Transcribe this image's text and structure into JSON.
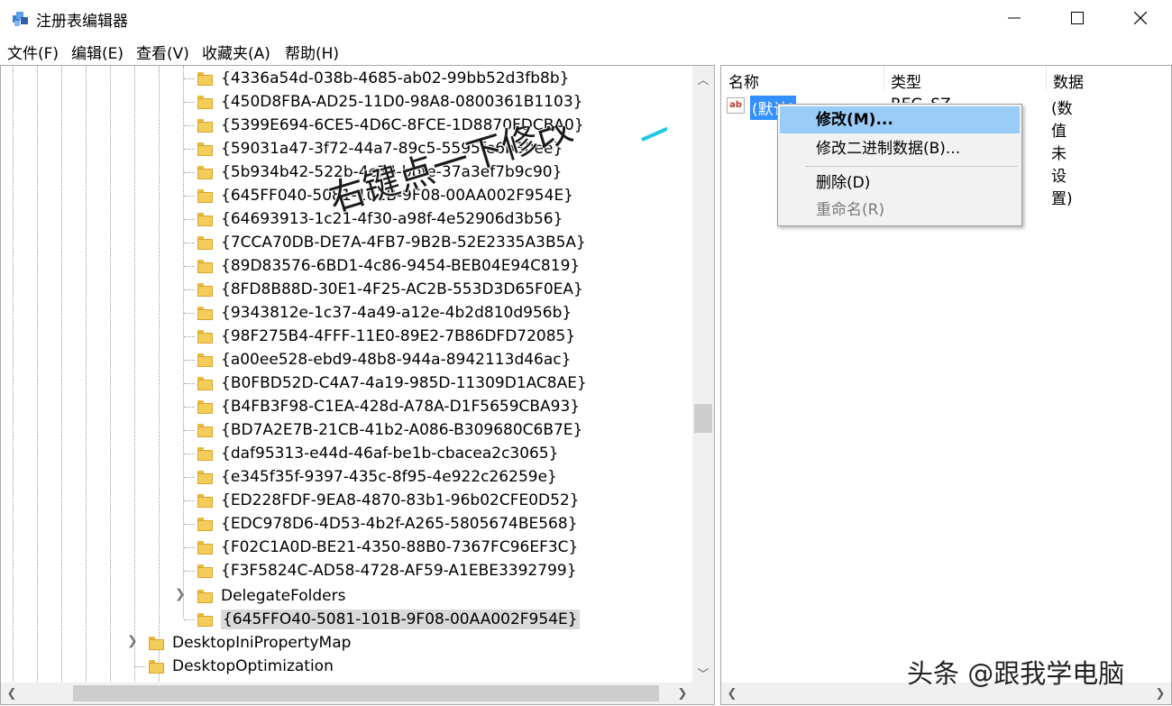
{
  "window": {
    "title": "注册表编辑器",
    "minimize": "—",
    "maximize": "☐",
    "close": "✕"
  },
  "menu": [
    "文件(F)",
    "编辑(E)",
    "查看(V)",
    "收藏夹(A)",
    "帮助(H)"
  ],
  "tree": {
    "guid_items": [
      "{4336a54d-038b-4685-ab02-99bb52d3fb8b}",
      "{450D8FBA-AD25-11D0-98A8-0800361B1103}",
      "{5399E694-6CE5-4D6C-8FCE-1D8870FDCBA0}",
      "{59031a47-3f72-44a7-89c5-5595fe6b30ee}",
      "{5b934b42-522b-4c34-bbfe-37a3ef7b9c90}",
      "{645FF040-5081-101B-9F08-00AA002F954E}",
      "{64693913-1c21-4f30-a98f-4e52906d3b56}",
      "{7CCA70DB-DE7A-4FB7-9B2B-52E2335A3B5A}",
      "{89D83576-6BD1-4c86-9454-BEB04E94C819}",
      "{8FD8B88D-30E1-4F25-AC2B-553D3D65F0EA}",
      "{9343812e-1c37-4a49-a12e-4b2d810d956b}",
      "{98F275B4-4FFF-11E0-89E2-7B86DFD72085}",
      "{a00ee528-ebd9-48b8-944a-8942113d46ac}",
      "{B0FBD52D-C4A7-4a19-985D-11309D1AC8AE}",
      "{B4FB3F98-C1EA-428d-A78A-D1F5659CBA93}",
      "{BD7A2E7B-21CB-41b2-A086-B309680C6B7E}",
      "{daf95313-e44d-46af-be1b-cbacea2c3065}",
      "{e345f35f-9397-435c-8f95-4e922c26259e}",
      "{ED228FDF-9EA8-4870-83b1-96b02CFE0D52}",
      "{EDC978D6-4D53-4b2f-A265-5805674BE568}",
      "{F02C1A0D-BE21-4350-88B0-7367FC96EF3C}",
      "{F3F5824C-AD58-4728-AF59-A1EBE3392799}"
    ],
    "delegate_folders": "DelegateFolders",
    "new_key": "{645FFO40-5081-101B-9F08-00AA002F954E}",
    "desktop_ini": "DesktopIniPropertyMap",
    "desktop_opt": "DesktopOptimization"
  },
  "values": {
    "headers": [
      "名称",
      "类型",
      "数据"
    ],
    "row": {
      "name": "(默认)",
      "type": "REG_SZ",
      "data": "(数值未设置)"
    }
  },
  "context_menu": {
    "modify": "修改(M)...",
    "modify_binary": "修改二进制数据(B)...",
    "delete": "删除(D)",
    "rename": "重命名(R)"
  },
  "annotation": {
    "text": "右键点一下修改",
    "color": "#1ec8e6"
  },
  "watermark": "头条 @跟我学电脑",
  "colors": {
    "selection": "#3390ff",
    "menu_highlight": "#99cdf8",
    "folder": "#f3cd5a"
  }
}
